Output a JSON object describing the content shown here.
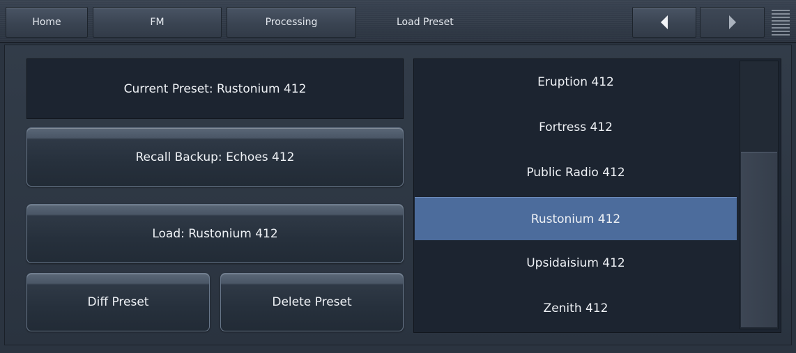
{
  "nav": {
    "home": "Home",
    "fm": "FM",
    "processing": "Processing",
    "page_title": "Load Preset",
    "back_icon": "triangle-left-icon",
    "forward_icon": "triangle-right-icon",
    "menu_icon": "menu-lines-icon"
  },
  "left": {
    "current_preset": "Current Preset: Rustonium 412",
    "recall_backup": "Recall Backup: Echoes 412",
    "load": "Load: Rustonium 412",
    "diff": "Diff Preset",
    "delete": "Delete Preset"
  },
  "presets": {
    "items": [
      {
        "label": "Eruption 412"
      },
      {
        "label": "Fortress 412"
      },
      {
        "label": "Public Radio 412"
      },
      {
        "label": "Rustonium 412"
      },
      {
        "label": "Upsidaisium 412"
      },
      {
        "label": "Zenith 412"
      }
    ],
    "selected": "Rustonium 412"
  },
  "colors": {
    "selected": "#4c6c9c",
    "background": "#2b3440",
    "panel": "#1c2430"
  }
}
